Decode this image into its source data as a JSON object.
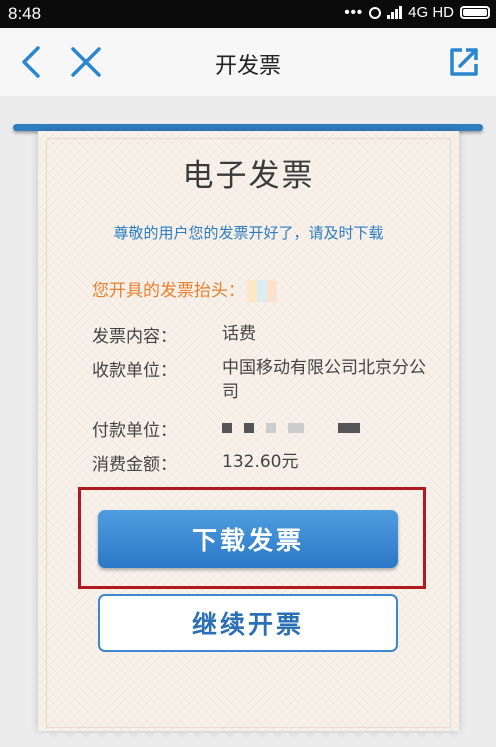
{
  "status_bar": {
    "time": "8:48",
    "dots": "•••",
    "network": "4G HD"
  },
  "nav": {
    "title": "开发票",
    "back_icon": "chevron-left-icon",
    "close_icon": "close-icon",
    "share_icon": "open-external-icon"
  },
  "invoice": {
    "title": "电子发票",
    "subtitle": "尊敬的用户您的发票开好了，请及时下载",
    "header_label": "您开具的发票抬头：",
    "rows": [
      {
        "label": "发票内容：",
        "value": "话费"
      },
      {
        "label": "收款单位：",
        "value": "中国移动有限公司北京分公司"
      },
      {
        "label": "付款单位：",
        "value": ""
      },
      {
        "label": "消费金额：",
        "value": "132.60元"
      }
    ]
  },
  "buttons": {
    "download": "下载发票",
    "continue": "继续开票"
  },
  "colors": {
    "accent_blue": "#2b78c6",
    "header_orange": "#e8802d",
    "highlight_red": "#b0191e"
  }
}
